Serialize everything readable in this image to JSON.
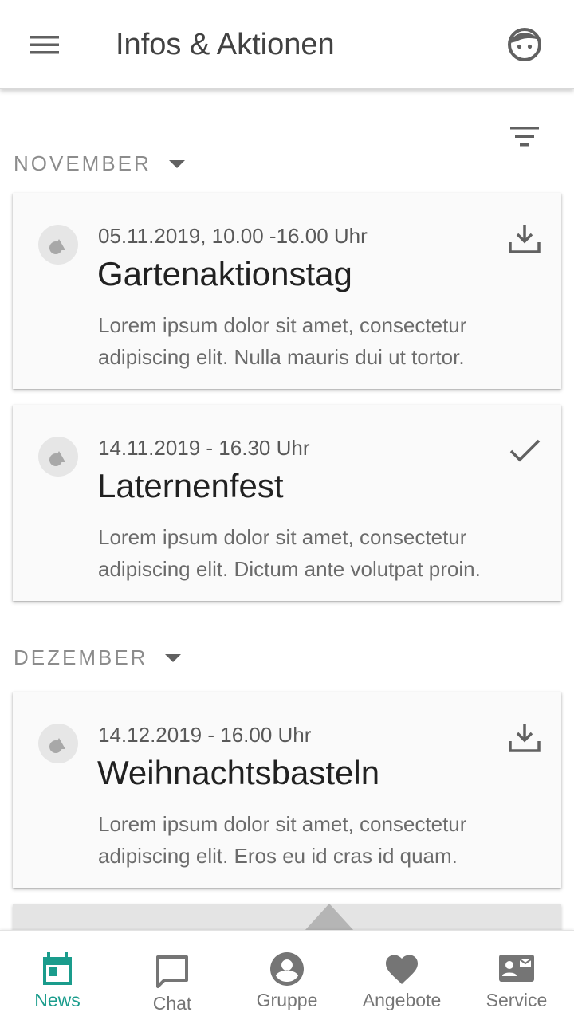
{
  "app_bar": {
    "title": "Infos & Aktionen",
    "menu_icon": "menu-icon",
    "profile_icon": "face-icon"
  },
  "filter_icon": "filter-icon",
  "sections": [
    {
      "label": "NOVEMBER",
      "events": [
        {
          "date": "05.11.2019, 10.00 -16.00 Uhr",
          "title": "Gartenaktionstag",
          "description": "Lorem ipsum dolor sit amet, consectetur adipiscing elit. Nulla mauris dui ut tortor.",
          "action_icon": "download-icon"
        },
        {
          "date": "14.11.2019 - 16.30 Uhr",
          "title": "Laternenfest",
          "description": "Lorem ipsum dolor sit amet, consectetur adipiscing elit. Dictum ante volutpat proin.",
          "action_icon": "check-icon"
        }
      ]
    },
    {
      "label": "DEZEMBER",
      "events": [
        {
          "date": "14.12.2019 - 16.00 Uhr",
          "title": "Weihnachtsbasteln",
          "description": "Lorem ipsum dolor sit amet, consectetur adipiscing elit. Eros eu id cras id quam.",
          "action_icon": "download-icon"
        }
      ]
    }
  ],
  "bottom_nav": [
    {
      "label": "News",
      "icon": "calendar-icon",
      "active": true
    },
    {
      "label": "Chat",
      "icon": "chat-icon",
      "active": false
    },
    {
      "label": "Gruppe",
      "icon": "account-circle-icon",
      "active": false
    },
    {
      "label": "Angebote",
      "icon": "heart-icon",
      "active": false
    },
    {
      "label": "Service",
      "icon": "contact-card-icon",
      "active": false
    }
  ],
  "colors": {
    "accent": "#1a9c8c",
    "icon_gray": "#616161",
    "card_bg": "#fafafa",
    "section_label": "#8c8c8c"
  }
}
